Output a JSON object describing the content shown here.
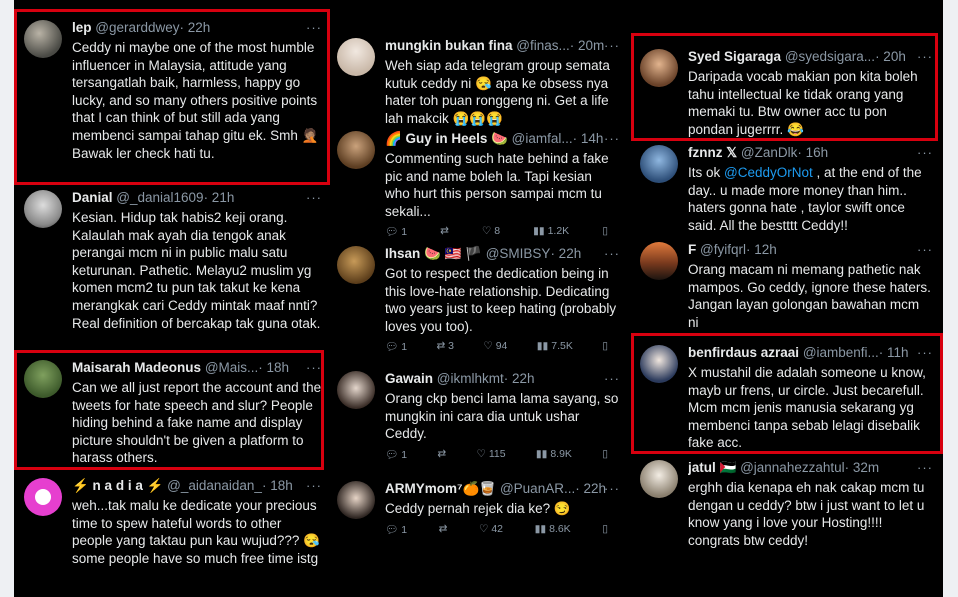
{
  "colors": {
    "highlight": "#d7000f",
    "background": "#000000",
    "text": "#e7e9ea",
    "handle": "#8b98a5",
    "mention": "#1d9bf0"
  },
  "col1": [
    {
      "name": "lep",
      "handle": "@gerarddwey",
      "time": "· 22h",
      "text": "Ceddy ni maybe one of the most humble influencer in Malaysia, attitude yang tersangatlah baik, harmless, happy go lucky, and so many others positive points that I can think of but still ada yang membenci sampai tahap gitu ek. Smh 🤦🏽 Bawak ler check hati tu."
    },
    {
      "name": "Danial",
      "handle": "@_danial1609",
      "time": "· 21h",
      "text": "Kesian. Hidup tak habis2 keji orang. Kalaulah mak ayah dia tengok anak perangai mcm ni in public malu satu keturunan. Pathetic. Melayu2 muslim yg komen mcm2 tu pun tak takut ke kena merangkak cari Ceddy mintak maaf nnti? Real definition of bercakap tak guna otak."
    },
    {
      "name": "Maisarah Madeonus",
      "handle": "@Mais...",
      "time": "· 18h",
      "text": "Can we all just report the account and the tweets for hate speech and slur? People hiding behind a fake name and display picture shouldn't be given a platform to harass others."
    },
    {
      "name": "⚡ n a d i a ⚡",
      "handle": "@_aidanaidan_",
      "time": "· 18h",
      "text": "weh...tak malu ke dedicate your precious time to spew hateful words to other people yang taktau pun kau wujud??? 😪 some people have so much free time istg"
    }
  ],
  "col2": [
    {
      "name": "mungkin bukan fina",
      "handle": "@finas...",
      "time": "· 20m",
      "text": "Weh siap ada telegram group semata kutuk ceddy ni 😪 apa ke obsess nya hater toh puan ronggeng ni. Get a life lah makcik 😭😭😭"
    },
    {
      "name": "🌈 Guy in Heels 🍉",
      "handle": "@iamfal...",
      "time": "· 14h",
      "text": "Commenting such hate behind a fake pic and name boleh la. Tapi kesian who hurt this person sampai mcm tu sekali...",
      "actions": {
        "replies": "1",
        "retweets": "",
        "likes": "8",
        "views": "1.2K"
      }
    },
    {
      "name": "Ihsan 🍉 🇲🇾 🏴",
      "handle": "@SMIBSY",
      "time": "· 22h",
      "text": "Got to respect the dedication being in this love-hate relationship. Dedicating two years just to keep hating (probably loves you too).",
      "actions": {
        "replies": "1",
        "retweets": "3",
        "likes": "94",
        "views": "7.5K"
      }
    },
    {
      "name": "Gawain",
      "handle": "@ikmlhkmt",
      "time": "· 22h",
      "text": "Orang ckp benci lama lama sayang, so mungkin ini cara dia untuk ushar Ceddy.",
      "actions": {
        "replies": "1",
        "retweets": "",
        "likes": "115",
        "views": "8.9K"
      }
    },
    {
      "name": "ARMYmom⁷🍊🥃",
      "handle": "@PuanAR...",
      "time": "· 22h",
      "text": "Ceddy pernah rejek dia ke? 😏",
      "actions": {
        "replies": "1",
        "retweets": "",
        "likes": "42",
        "views": "8.6K"
      }
    }
  ],
  "col3": [
    {
      "name": "Syed Sigaraga",
      "handle": "@syedsigara...",
      "time": "· 20h",
      "text": "Daripada vocab makian pon kita boleh tahu intellectual ke tidak orang yang memaki tu. Btw owner acc tu pon pondan jugerrrr. 😂"
    },
    {
      "name": "fznnz 𝕏",
      "handle": "@ZanDlk",
      "time": "· 16h",
      "text_pre": "Its ok ",
      "mention": "@CeddyOrNot",
      "text_post": " , at the end of the day.. u made more money than him.. haters gonna hate , taylor swift once said. All the bestttt Ceddy!!"
    },
    {
      "name": "F",
      "handle": "@fyifqrl",
      "time": "· 12h",
      "text": "Orang macam ni memang pathetic nak mampos. Go ceddy, ignore these haters. Jangan layan golongan bawahan mcm ni"
    },
    {
      "name": "benfirdaus azraai",
      "handle": "@iamben­fi...",
      "time": "· 11h",
      "text": "X mustahil die adalah someone u know, mayb ur frens, ur circle. Just becarefull. Mcm mcm jenis manusia sekarang yg membenci tanpa sebab lelagi disebalik fake acc."
    },
    {
      "name": "jatul 🇵🇸",
      "handle": "@jannahezzahtul",
      "time": "· 32m",
      "text": "erghh dia kenapa eh nak cakap mcm tu dengan u ceddy? btw i just want to let u know yang i love your Hosting!!!! congrats btw ceddy!"
    }
  ]
}
